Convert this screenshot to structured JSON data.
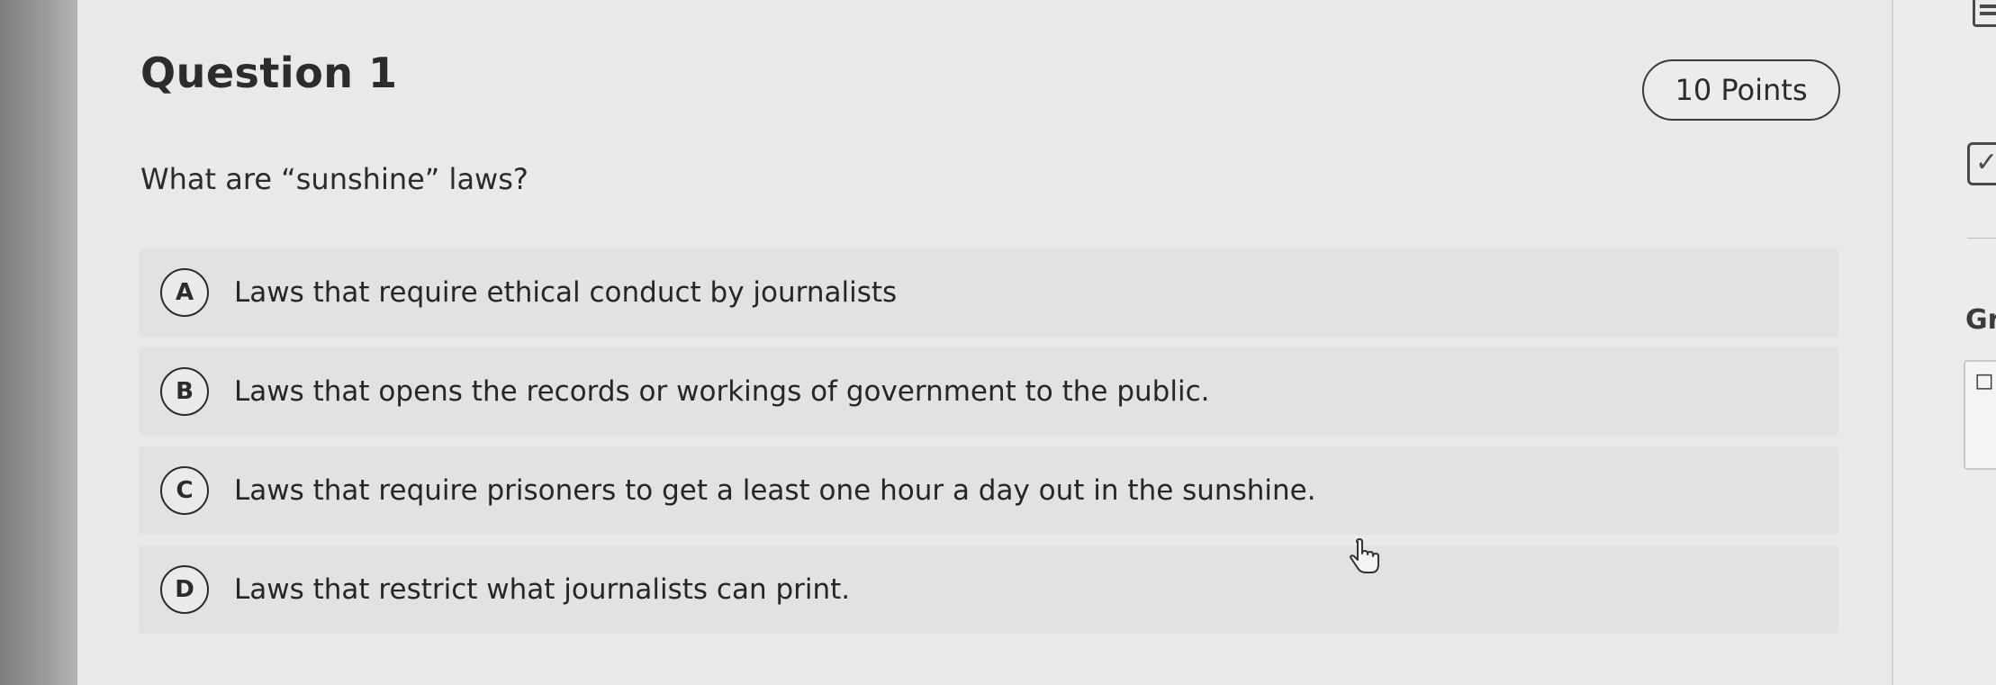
{
  "question": {
    "title": "Question 1",
    "points": "10 Points",
    "prompt": "What are “sunshine” laws?"
  },
  "answers": [
    {
      "letter": "A",
      "text": "Laws that require ethical conduct by journalists"
    },
    {
      "letter": "B",
      "text": "Laws that opens the records or workings of government to the public."
    },
    {
      "letter": "C",
      "text": "Laws that require prisoners to get a least one hour a day out in the sunshine."
    },
    {
      "letter": "D",
      "text": "Laws that restrict what journalists can print."
    }
  ],
  "right_panel": {
    "grade_label": "Gr",
    "icons": [
      "grid-icon",
      "checklist-icon"
    ]
  },
  "colors": {
    "background": "#e9e9e9",
    "answer_row": "#e2e2e2",
    "text": "#2b2b2b"
  }
}
